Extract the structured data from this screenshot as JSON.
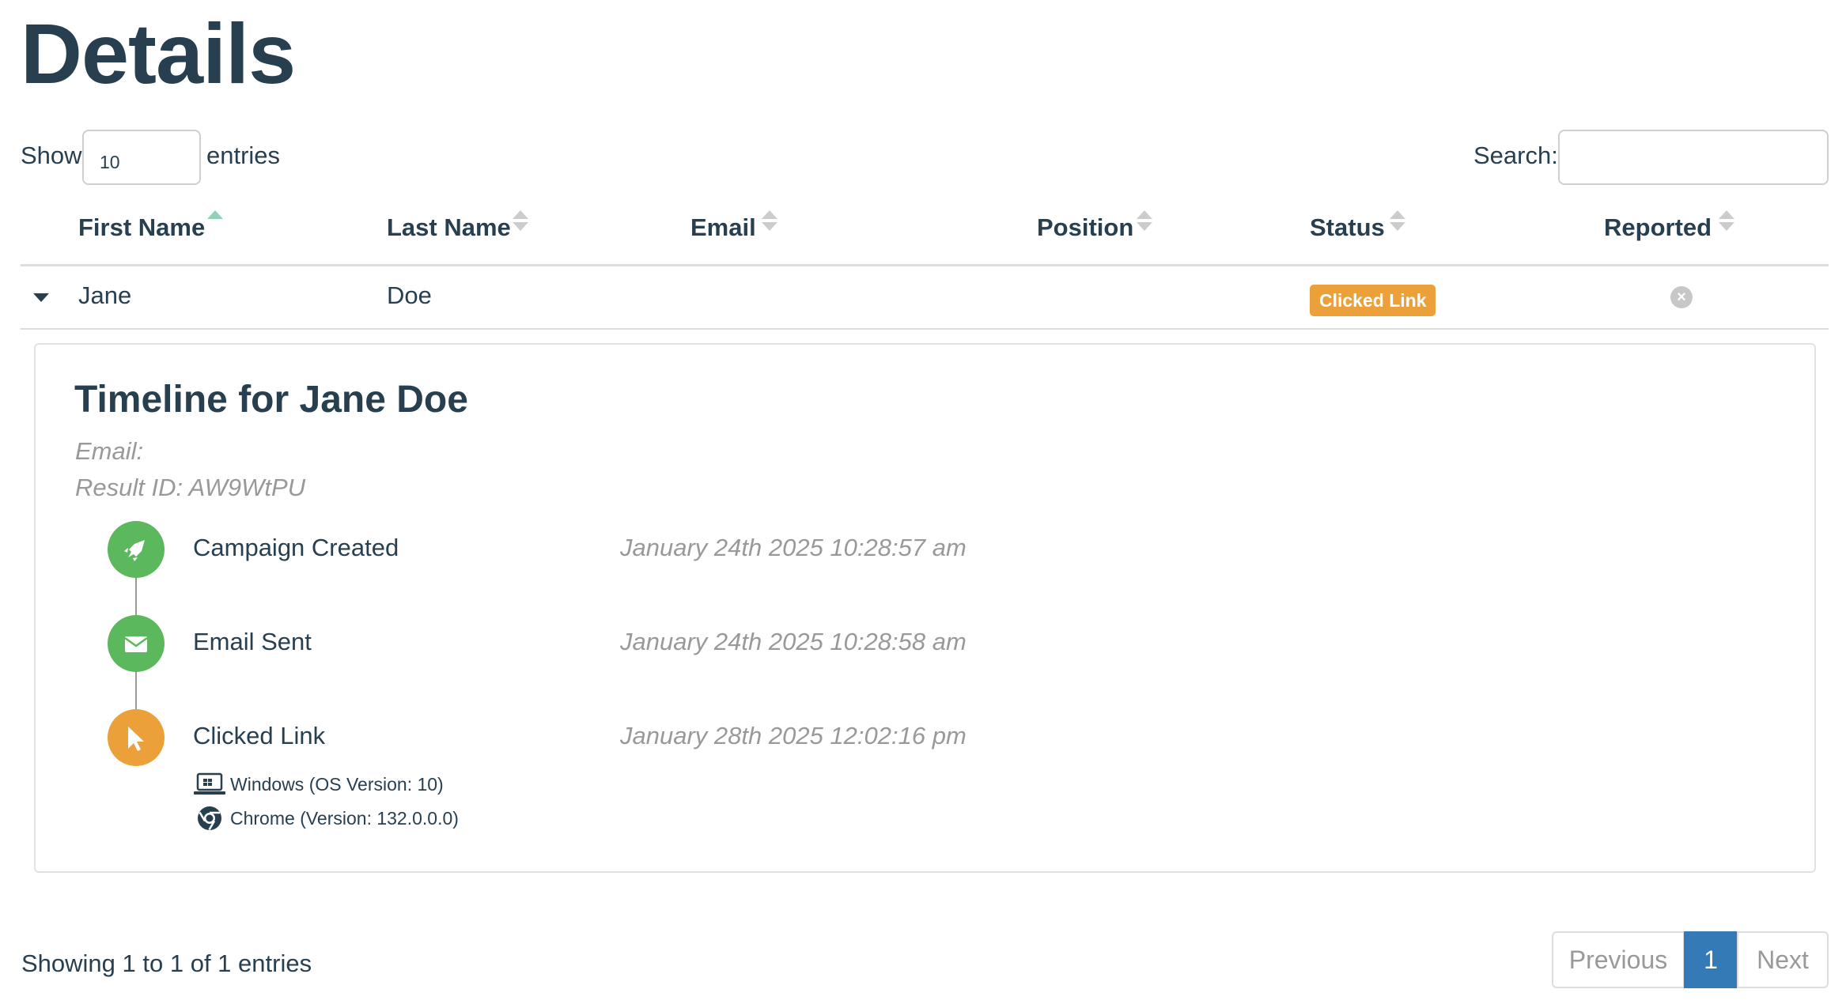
{
  "page": {
    "title": "Details"
  },
  "controls": {
    "show_label": "Show",
    "page_length": "10",
    "entries_label": "entries",
    "search_label": "Search:",
    "search_value": ""
  },
  "table": {
    "columns": [
      {
        "label": "First Name",
        "sort": "asc"
      },
      {
        "label": "Last Name",
        "sort": "none"
      },
      {
        "label": "Email",
        "sort": "none"
      },
      {
        "label": "Position",
        "sort": "none"
      },
      {
        "label": "Status",
        "sort": "none"
      },
      {
        "label": "Reported",
        "sort": "none"
      }
    ],
    "rows": [
      {
        "first_name": "Jane",
        "last_name": "Doe",
        "email": "",
        "position": "",
        "status": "Clicked Link",
        "reported_icon": "x-circle-icon"
      }
    ]
  },
  "timeline": {
    "title": "Timeline for Jane Doe",
    "email_line": "Email:",
    "result_id_line": "Result ID: AW9WtPU",
    "events": [
      {
        "label": "Campaign Created",
        "time": "January 24th 2025 10:28:57 am",
        "icon": "rocket-icon",
        "color": "#5cb85c"
      },
      {
        "label": "Email Sent",
        "time": "January 24th 2025 10:28:58 am",
        "icon": "envelope-icon",
        "color": "#5cb85c"
      },
      {
        "label": "Clicked Link",
        "time": "January 28th 2025 12:02:16 pm",
        "icon": "mouse-pointer-icon",
        "color": "#eba03a",
        "details": [
          {
            "icon": "laptop-icon",
            "text": "Windows (OS Version: 10)"
          },
          {
            "icon": "chrome-icon",
            "text": "Chrome (Version: 132.0.0.0)"
          }
        ]
      }
    ]
  },
  "footer": {
    "info": "Showing 1 to 1 of 1 entries",
    "previous_label": "Previous",
    "current_page": "1",
    "next_label": "Next"
  },
  "colors": {
    "heading": "#283f50",
    "status_badge": "#eba03a",
    "success": "#5cb85c",
    "pagination_active": "#337ab7",
    "muted": "#999999"
  }
}
